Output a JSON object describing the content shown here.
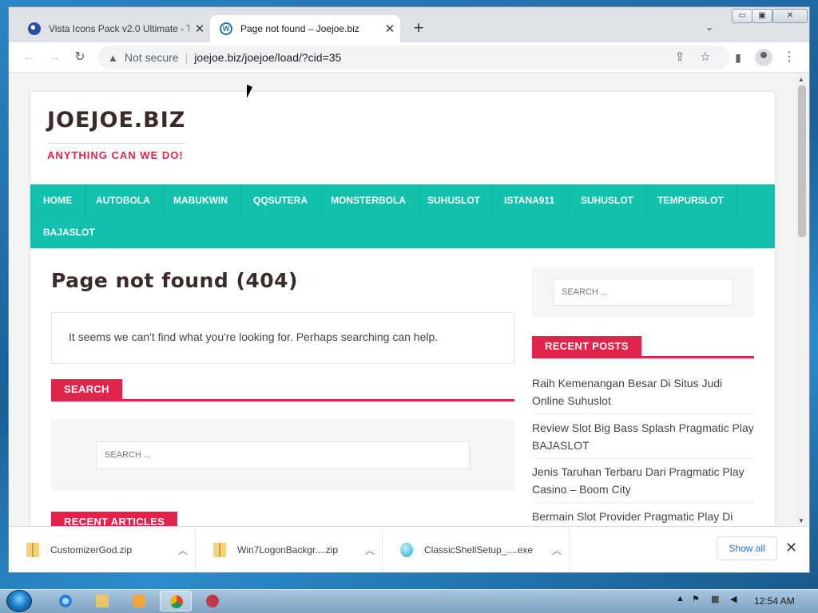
{
  "browser": {
    "tabs": [
      {
        "title": "Vista Icons Pack v2.0 Ultimate - T",
        "active": false,
        "favicon_icon": "globe-icon"
      },
      {
        "title": "Page not found – Joejoe.biz",
        "active": true,
        "favicon_icon": "wordpress-icon"
      }
    ],
    "address": {
      "security": "Not secure",
      "url": "joejoe.biz/joejoe/load/?cid=35"
    }
  },
  "site": {
    "brand": "JOEJOE.BIZ",
    "tagline": "ANYTHING CAN WE DO!",
    "nav": [
      "HOME",
      "AUTOBOLA",
      "MABUKWIN",
      "QQSUTERA",
      "MONSTERBOLA",
      "SUHUSLOT",
      "ISTANA911",
      "SUHUSLOT",
      "TEMPURSLOT",
      "BAJASLOT"
    ],
    "heading": "Page not found (404)",
    "notice": "It seems we can't find what you're looking for. Perhaps searching can help.",
    "search_section": "SEARCH",
    "search_placeholder": "SEARCH ...",
    "recent_articles": "RECENT ARTICLES",
    "sidebar_search_placeholder": "SEARCH ...",
    "recent_posts_title": "RECENT POSTS",
    "recent_posts": [
      "Raih Kemenangan Besar Di Situs Judi Online Suhuslot",
      "Review Slot Big Bass Splash Pragmatic Play BAJASLOT",
      "Jenis Taruhan Terbaru Dari Pragmatic Play Casino – Boom City",
      "Bermain Slot Provider Pragmatic Play Di"
    ]
  },
  "downloads": {
    "items": [
      "CustomizerGod.zip",
      "Win7LogonBackgr....zip",
      "ClassicShellSetup_....exe"
    ],
    "show_all": "Show all"
  },
  "taskbar": {
    "clock": "12:54 AM"
  },
  "colors": {
    "accent_teal": "#11c1ad",
    "accent_red": "#e2244d",
    "brand_text": "#3b2a2a"
  }
}
